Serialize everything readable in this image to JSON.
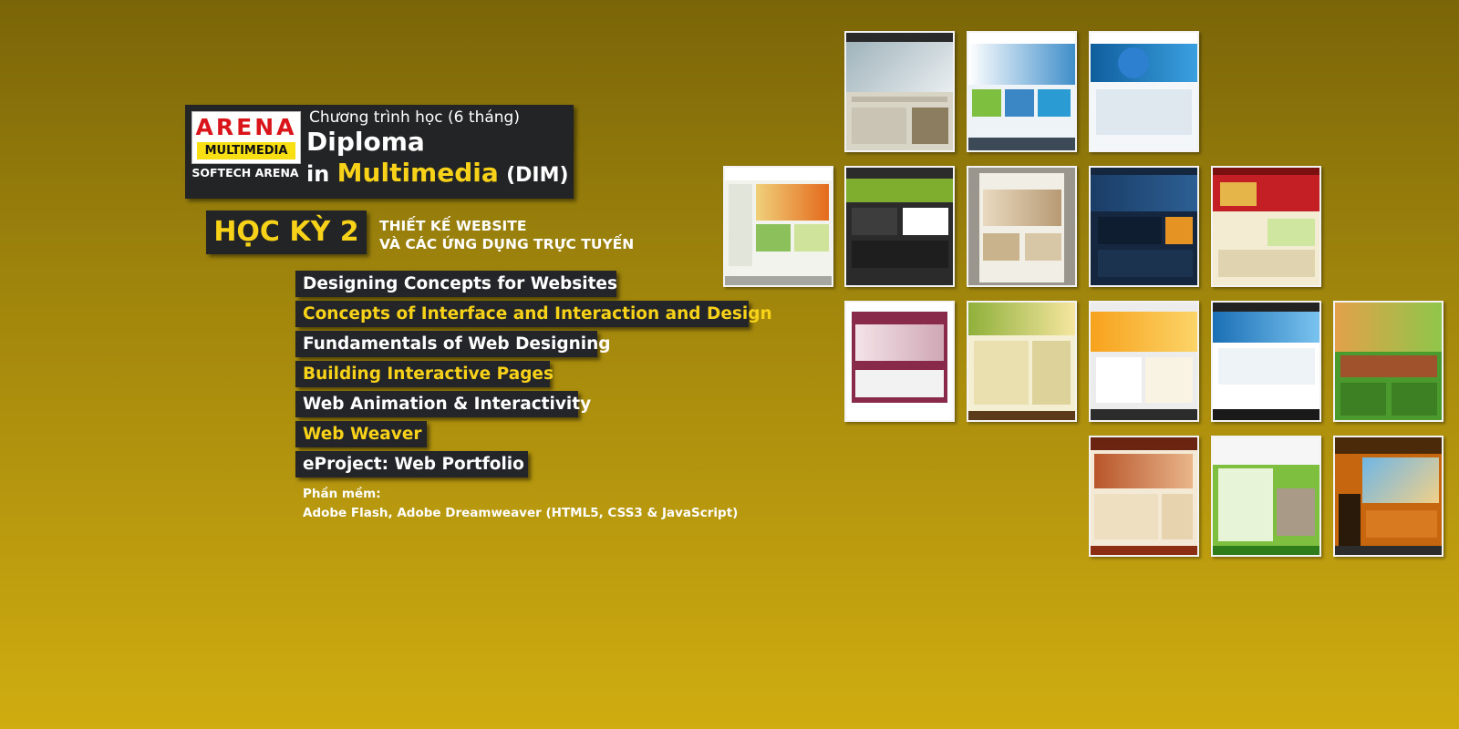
{
  "logo": {
    "arena": "ARENA",
    "multimedia": "MULTIMEDIA",
    "subtitle": "SOFTECH ARENA"
  },
  "program": {
    "line1": "Chương trình học (6 tháng)",
    "diploma": "Diploma",
    "in": "in",
    "multimedia": "Multimedia",
    "dim": "(DIM)"
  },
  "semester": {
    "badge": "HỌC KỲ 2",
    "title_line1": "THIẾT KẾ WEBSITE",
    "title_line2": "VÀ CÁC ỨNG DỤNG TRỰC TUYẾN"
  },
  "courses": [
    {
      "label": "Designing Concepts for Websites",
      "color": "#ffffff"
    },
    {
      "label": "Concepts of Interface and Interaction and Design",
      "color": "#f7d218"
    },
    {
      "label": "Fundamentals of Web Designing",
      "color": "#ffffff"
    },
    {
      "label": "Building Interactive Pages",
      "color": "#f7d218"
    },
    {
      "label": "Web Animation & Interactivity",
      "color": "#ffffff"
    },
    {
      "label": "Web Weaver",
      "color": "#f7d218"
    },
    {
      "label": "eProject: Web Portfolio",
      "color": "#ffffff"
    }
  ],
  "software": {
    "label": "Phần mềm:",
    "list": "Adobe Flash, Adobe Dreamweaver (HTML5, CSS3 & JavaScript)"
  },
  "colors": {
    "accent": "#f7d218",
    "panel": "#222426",
    "background_top": "#7a6508",
    "background_bottom": "#cfad10"
  }
}
